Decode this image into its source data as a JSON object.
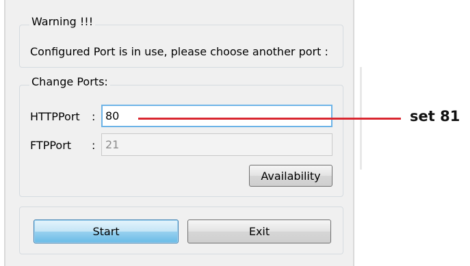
{
  "warning": {
    "title": "Warning !!!",
    "message": "Configured Port is in use, please choose another port :"
  },
  "change_ports": {
    "title": "Change Ports:",
    "http_label": "HTTPPort",
    "http_colon": ":",
    "http_value": "80",
    "ftp_label": "FTPPort",
    "ftp_colon": ":",
    "ftp_value": "21",
    "availability_button": "Availability"
  },
  "actions": {
    "start_button": "Start",
    "exit_button": "Exit"
  },
  "annotation": {
    "text": "set 81",
    "color": "#d9262f"
  }
}
